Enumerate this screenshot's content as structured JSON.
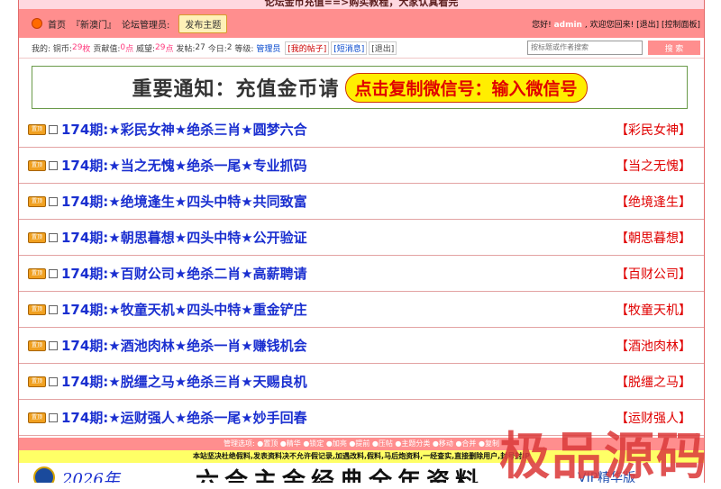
{
  "top_notice": "论坛金币充值==>购买教程，大家认真看完",
  "nav": {
    "home": "首页",
    "new_macau": "『新澳门』",
    "forum_admin": "论坛管理员:",
    "post_topic": "发布主题",
    "greeting": "您好!",
    "username": "admin",
    "welcome": ", 欢迎您回来!",
    "logout": "[退出]",
    "control_panel": "[控制面板]"
  },
  "stats": {
    "mine": "我的:",
    "copper_label": "铜币:",
    "copper_value": "29",
    "copper_unit": "枚",
    "contrib_label": "贡献值:",
    "contrib_value": "0",
    "contrib_unit": "点",
    "fame_label": "威望:",
    "fame_value": "29",
    "fame_unit": "点",
    "posts_label": "发帖:",
    "posts_value": "27",
    "today_label": "今日:",
    "today_value": "2",
    "level_label": "等级:",
    "level_value": "管理员",
    "my_posts": "[我的帖子]",
    "messages": "[短消息]",
    "exit": "[退出]"
  },
  "search": {
    "placeholder": "按标题或作者搜索",
    "button": "搜  索"
  },
  "announcement": {
    "text": "重要通知：充值金币请",
    "button": "点击复制微信号：输入微信号"
  },
  "tag_icon": "置顶",
  "threads": [
    {
      "title": "174期:★彩民女神★绝杀三肖★圆梦六合",
      "author": "【彩民女神】"
    },
    {
      "title": "174期:★当之无愧★绝杀一尾★专业抓码",
      "author": "【当之无愧】"
    },
    {
      "title": "174期:★绝境逢生★四头中特★共同致富",
      "author": "【绝境逢生】"
    },
    {
      "title": "174期:★朝思暮想★四头中特★公开验证",
      "author": "【朝思暮想】"
    },
    {
      "title": "174期:★百财公司★绝杀二肖★高薪聘请",
      "author": "【百财公司】"
    },
    {
      "title": "174期:★牧童天机★四头中特★重金铲庄",
      "author": "【牧童天机】"
    },
    {
      "title": "174期:★酒池肉林★绝杀一肖★赚钱机会",
      "author": "【酒池肉林】"
    },
    {
      "title": "174期:★脱缰之马★绝杀三肖★天赐良机",
      "author": "【脱缰之马】"
    },
    {
      "title": "174期:★运财强人★绝杀一尾★妙手回春",
      "author": "【运财强人】"
    }
  ],
  "admin_bar": "管理选项: ●置顶 ●精华 ●锁定 ●加亮 ●提前 ●压帖 ●主题分类 ●移动 ●合并 ●复制",
  "yellow_bar": "本站坚决杜绝假料,发表资料决不允许假记录,加遇改料,假料,马后炮资料,一经查实,直接删除用户,封号封IP",
  "banner": {
    "year": "2026年",
    "text": "六合主金经典全年资料",
    "vip": "VIP精华版"
  },
  "watermark": "极品源码"
}
